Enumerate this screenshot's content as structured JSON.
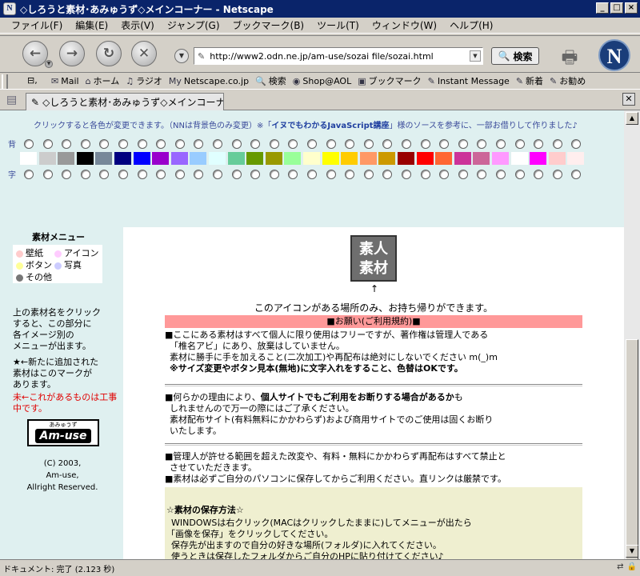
{
  "window": {
    "title": "◇しろうと素材･あみゅうず◇メインコーナー - Netscape",
    "app_icon": "N"
  },
  "menu": [
    "ファイル(F)",
    "編集(E)",
    "表示(V)",
    "ジャンプ(G)",
    "ブックマーク(B)",
    "ツール(T)",
    "ウィンドウ(W)",
    "ヘルプ(H)"
  ],
  "nav": {
    "url": "http://www2.odn.ne.jp/am-use/sozai file/sozai.html",
    "search_label": "検索"
  },
  "personal_bar": [
    {
      "icon": "mail-icon",
      "glyph": "✉",
      "label": "Mail"
    },
    {
      "icon": "home-icon",
      "glyph": "⌂",
      "label": "ホーム"
    },
    {
      "icon": "radio-icon",
      "glyph": "♫",
      "label": "ラジオ"
    },
    {
      "icon": "my-icon",
      "glyph": "My",
      "label": "Netscape.co.jp"
    },
    {
      "icon": "search-icon",
      "glyph": "🔍",
      "label": "検索"
    },
    {
      "icon": "aol-icon",
      "glyph": "◉",
      "label": "Shop@AOL"
    },
    {
      "icon": "bookmark-folder-icon",
      "glyph": "▣",
      "label": "ブックマーク"
    },
    {
      "icon": "im-icon",
      "glyph": "✎",
      "label": "Instant Message"
    },
    {
      "icon": "new-icon",
      "glyph": "✎",
      "label": "新着"
    },
    {
      "icon": "recommend-icon",
      "glyph": "✎",
      "label": "お勧め"
    }
  ],
  "tab": {
    "title": "◇しろうと素材･あみゅうず◇メインコーナー"
  },
  "intro": {
    "pre": "クリックすると各色が変更できます。（NNは背景色のみ変更）※「",
    "link": "イヌでもわかるJavaScript講座",
    "post": "」様のソースを参考に、一部お借りして作りました♪"
  },
  "color_picker": {
    "bg_label": "背",
    "text_label": "字",
    "colors": [
      "#ffffff",
      "#cccccc",
      "#999999",
      "#000000",
      "#778899",
      "#000080",
      "#0000ff",
      "#9900cc",
      "#9966ff",
      "#99ccff",
      "#e0ffff",
      "#66cc99",
      "#669900",
      "#999900",
      "#99ff99",
      "#ffffcc",
      "#ffff00",
      "#ffcc00",
      "#ff9966",
      "#cc9900",
      "#990000",
      "#ff0000",
      "#ff6633",
      "#cc3399",
      "#cc6699",
      "#ff99ff",
      "#ffffff",
      "#ff00ff",
      "#ffcccc",
      "#ffeeee"
    ]
  },
  "sidebar": {
    "title": "素材メニュー",
    "menu": [
      {
        "label": "壁紙",
        "color": "#ffcccc"
      },
      {
        "label": "アイコン",
        "color": "#ffccff"
      },
      {
        "label": "ボタン",
        "color": "#ffff99"
      },
      {
        "label": "写真",
        "color": "#ccccff"
      },
      {
        "label": "その他",
        "color": "#777777"
      }
    ],
    "help": [
      "上の素材名をクリック",
      "すると、この部分に",
      "各イメージ別の",
      "メニューが出ます。"
    ],
    "new_note": [
      "★←新たに追加された",
      "素材はこのマークが",
      "あります。"
    ],
    "flaw_note": [
      "未←これがあるものは工事",
      "中です。"
    ],
    "logo_small": "あみゅうず",
    "logo_big": "Am-use",
    "copyright": [
      "(C) 2003,",
      "Am-use,",
      "Allright Reserved."
    ]
  },
  "main": {
    "icon_line1": "素人",
    "icon_line2": "素材",
    "arrow": "↑",
    "icon_note": "このアイコンがある場所のみ、お持ち帰りができます。",
    "request_header": "■お願い(ご利用規約)■",
    "rule1": [
      "■ここにある素材はすべて個人に限り使用はフリーですが、著作権は管理人である",
      "「椎名アビ」にあり、放棄はしていません。",
      "素材に勝手に手を加えること(二次加工)や再配布は絶対にしないでください m(_)m",
      "※サイズ変更やボタン見本(無地)に文字入れをすること、色替はOKです。"
    ],
    "rule2": {
      "pre": "■何らかの理由により、",
      "bold": "個人サイトでもご利用をお断りする場合があるか",
      "post": "も",
      "lines": [
        "しれませんので万一の際にはご了承ください。",
        "素材配布サイト(有料無料にかかわらず)および商用サイトでのご使用は固くお断り",
        "いたします。"
      ]
    },
    "rule3": [
      "■管理人が許せる範囲を超えた改変や、有料・無料にかかわらず再配布はすべて禁止と",
      "させていただきます。",
      "■素材は必ずご自分のパソコンに保存してからご利用ください。直リンクは厳禁です。"
    ],
    "save_title": "☆素材の保存方法☆",
    "save_lines": [
      "WINDOWSは右クリック(MACはクリックしたままに)してメニューが出たら",
      "「画像を保存」をクリックしてください。",
      "保存先が出ますので自分の好きな場所(フォルダ)に入れてください。",
      "使うときは保存したフォルダからご自分のHPに貼り付けてください♪"
    ]
  },
  "status": {
    "text": "ドキュメント: 完了 (2.123 秒)"
  }
}
